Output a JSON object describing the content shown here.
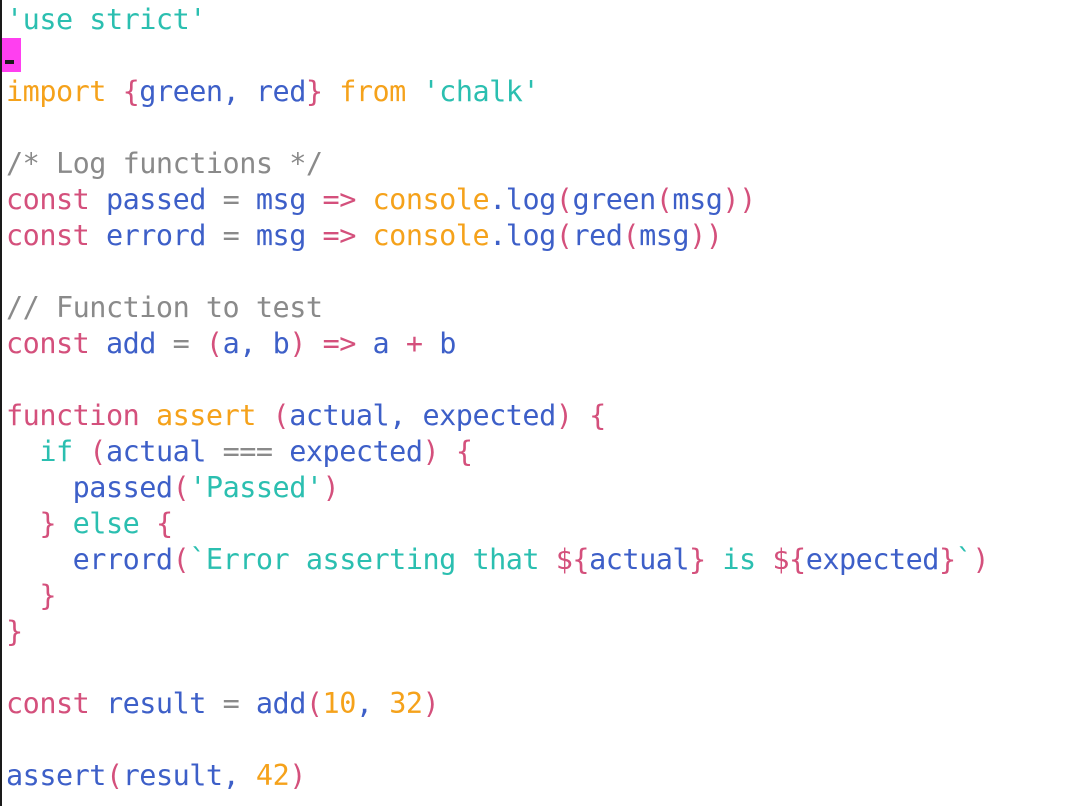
{
  "editor": {
    "cursor_color": "#ff3ff0",
    "colors": {
      "keyword": "#d4507c",
      "identifier": "#3d5fc8",
      "string": "#2bbfb0",
      "function": "#f5a21b",
      "comment": "#8a8a8a",
      "number": "#f5a21b",
      "punct": "#8a8a8a"
    },
    "lines": [
      [
        {
          "t": "'use strict'",
          "c": "string"
        }
      ],
      [],
      [
        {
          "t": "import ",
          "c": "function"
        },
        {
          "t": "{",
          "c": "keyword"
        },
        {
          "t": "green, red",
          "c": "identifier"
        },
        {
          "t": "}",
          "c": "keyword"
        },
        {
          "t": " from ",
          "c": "function"
        },
        {
          "t": "'chalk'",
          "c": "string"
        }
      ],
      [],
      [
        {
          "t": "/* Log functions */",
          "c": "comment"
        }
      ],
      [
        {
          "t": "const ",
          "c": "keyword"
        },
        {
          "t": "passed ",
          "c": "identifier"
        },
        {
          "t": "= ",
          "c": "punct"
        },
        {
          "t": "msg ",
          "c": "identifier"
        },
        {
          "t": "=>",
          "c": "keyword"
        },
        {
          "t": " console",
          "c": "function"
        },
        {
          "t": ".log",
          "c": "identifier"
        },
        {
          "t": "(",
          "c": "keyword"
        },
        {
          "t": "green",
          "c": "identifier"
        },
        {
          "t": "(",
          "c": "keyword"
        },
        {
          "t": "msg",
          "c": "identifier"
        },
        {
          "t": "))",
          "c": "keyword"
        }
      ],
      [
        {
          "t": "const ",
          "c": "keyword"
        },
        {
          "t": "errord ",
          "c": "identifier"
        },
        {
          "t": "= ",
          "c": "punct"
        },
        {
          "t": "msg ",
          "c": "identifier"
        },
        {
          "t": "=>",
          "c": "keyword"
        },
        {
          "t": " console",
          "c": "function"
        },
        {
          "t": ".log",
          "c": "identifier"
        },
        {
          "t": "(",
          "c": "keyword"
        },
        {
          "t": "red",
          "c": "identifier"
        },
        {
          "t": "(",
          "c": "keyword"
        },
        {
          "t": "msg",
          "c": "identifier"
        },
        {
          "t": "))",
          "c": "keyword"
        }
      ],
      [],
      [
        {
          "t": "// Function to test",
          "c": "comment"
        }
      ],
      [
        {
          "t": "const ",
          "c": "keyword"
        },
        {
          "t": "add ",
          "c": "identifier"
        },
        {
          "t": "= ",
          "c": "punct"
        },
        {
          "t": "(",
          "c": "keyword"
        },
        {
          "t": "a, b",
          "c": "identifier"
        },
        {
          "t": ") ",
          "c": "keyword"
        },
        {
          "t": "=>",
          "c": "keyword"
        },
        {
          "t": " a ",
          "c": "identifier"
        },
        {
          "t": "+ ",
          "c": "keyword"
        },
        {
          "t": "b",
          "c": "identifier"
        }
      ],
      [],
      [
        {
          "t": "function ",
          "c": "keyword"
        },
        {
          "t": "assert ",
          "c": "function"
        },
        {
          "t": "(",
          "c": "keyword"
        },
        {
          "t": "actual, expected",
          "c": "identifier"
        },
        {
          "t": ") {",
          "c": "keyword"
        }
      ],
      [
        {
          "t": "  if ",
          "c": "string"
        },
        {
          "t": "(",
          "c": "keyword"
        },
        {
          "t": "actual ",
          "c": "identifier"
        },
        {
          "t": "=== ",
          "c": "punct"
        },
        {
          "t": "expected",
          "c": "identifier"
        },
        {
          "t": ") {",
          "c": "keyword"
        }
      ],
      [
        {
          "t": "    passed",
          "c": "identifier"
        },
        {
          "t": "(",
          "c": "keyword"
        },
        {
          "t": "'Passed'",
          "c": "string"
        },
        {
          "t": ")",
          "c": "keyword"
        }
      ],
      [
        {
          "t": "  } ",
          "c": "keyword"
        },
        {
          "t": "else ",
          "c": "string"
        },
        {
          "t": "{",
          "c": "keyword"
        }
      ],
      [
        {
          "t": "    errord",
          "c": "identifier"
        },
        {
          "t": "(",
          "c": "keyword"
        },
        {
          "t": "`Error asserting that ",
          "c": "string"
        },
        {
          "t": "${",
          "c": "keyword"
        },
        {
          "t": "actual",
          "c": "identifier"
        },
        {
          "t": "}",
          "c": "keyword"
        },
        {
          "t": " is ",
          "c": "string"
        },
        {
          "t": "${",
          "c": "keyword"
        },
        {
          "t": "expected",
          "c": "identifier"
        },
        {
          "t": "}",
          "c": "keyword"
        },
        {
          "t": "`",
          "c": "string"
        },
        {
          "t": ")",
          "c": "keyword"
        }
      ],
      [
        {
          "t": "  }",
          "c": "keyword"
        }
      ],
      [
        {
          "t": "}",
          "c": "keyword"
        }
      ],
      [],
      [
        {
          "t": "const ",
          "c": "keyword"
        },
        {
          "t": "result ",
          "c": "identifier"
        },
        {
          "t": "= ",
          "c": "punct"
        },
        {
          "t": "add",
          "c": "identifier"
        },
        {
          "t": "(",
          "c": "keyword"
        },
        {
          "t": "10",
          "c": "number"
        },
        {
          "t": ", ",
          "c": "identifier"
        },
        {
          "t": "32",
          "c": "number"
        },
        {
          "t": ")",
          "c": "keyword"
        }
      ],
      [],
      [
        {
          "t": "assert",
          "c": "identifier"
        },
        {
          "t": "(",
          "c": "keyword"
        },
        {
          "t": "result, ",
          "c": "identifier"
        },
        {
          "t": "42",
          "c": "number"
        },
        {
          "t": ")",
          "c": "keyword"
        }
      ]
    ]
  }
}
